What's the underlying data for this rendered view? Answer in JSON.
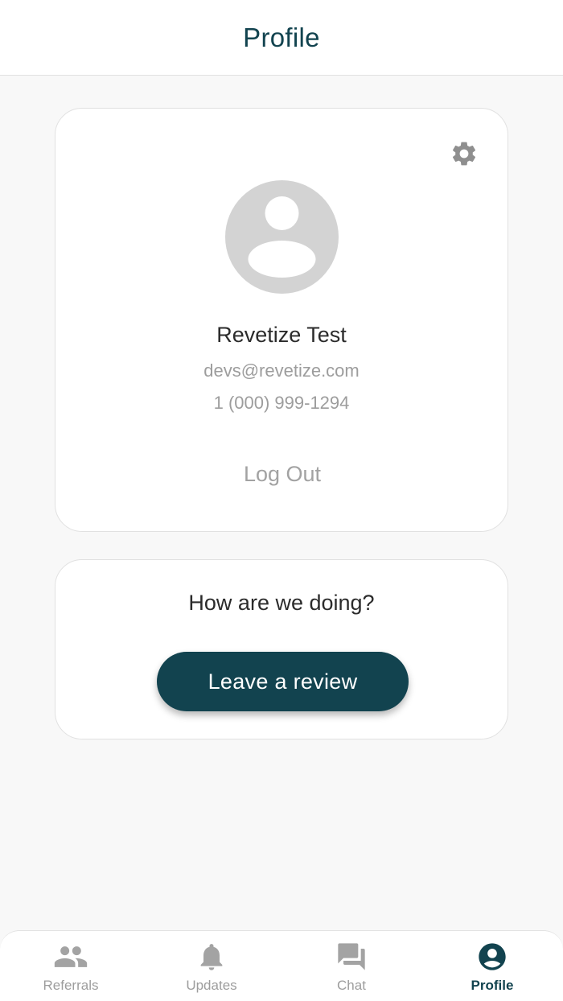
{
  "header": {
    "title": "Profile"
  },
  "profile": {
    "name": "Revetize Test",
    "email": "devs@revetize.com",
    "phone": "1 (000) 999-1294",
    "logout_label": "Log Out",
    "settings_icon": "gear-icon",
    "avatar_icon": "user-avatar-placeholder"
  },
  "review": {
    "heading": "How are we doing?",
    "button_label": "Leave a review"
  },
  "nav": {
    "items": [
      {
        "label": "Referrals",
        "icon": "people-icon",
        "active": false
      },
      {
        "label": "Updates",
        "icon": "bell-icon",
        "active": false
      },
      {
        "label": "Chat",
        "icon": "chat-icon",
        "active": false
      },
      {
        "label": "Profile",
        "icon": "account-circle-icon",
        "active": true
      }
    ]
  },
  "colors": {
    "primary": "#12434f",
    "muted_text": "#9d9d9d",
    "icon_gray": "#8f8f8f",
    "avatar_gray": "#d3d3d3",
    "background": "#f8f8f8"
  }
}
